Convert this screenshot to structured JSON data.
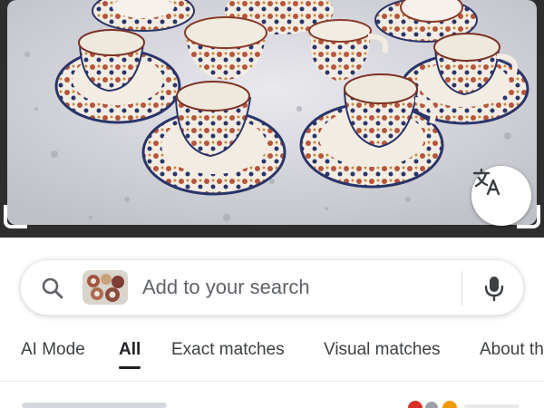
{
  "search": {
    "placeholder": "Add to your search"
  },
  "tabs": [
    {
      "label": "AI Mode"
    },
    {
      "label": "All"
    },
    {
      "label": "Exact matches"
    },
    {
      "label": "Visual matches"
    },
    {
      "label": "About th"
    }
  ],
  "active_tab": "All",
  "icons": {
    "translate": "translate-icon",
    "search": "search-icon",
    "mic": "microphone-icon"
  },
  "colors": {
    "accent_google_blue": "#4285f4",
    "text_primary": "#202124",
    "text_secondary": "#5f6368"
  }
}
